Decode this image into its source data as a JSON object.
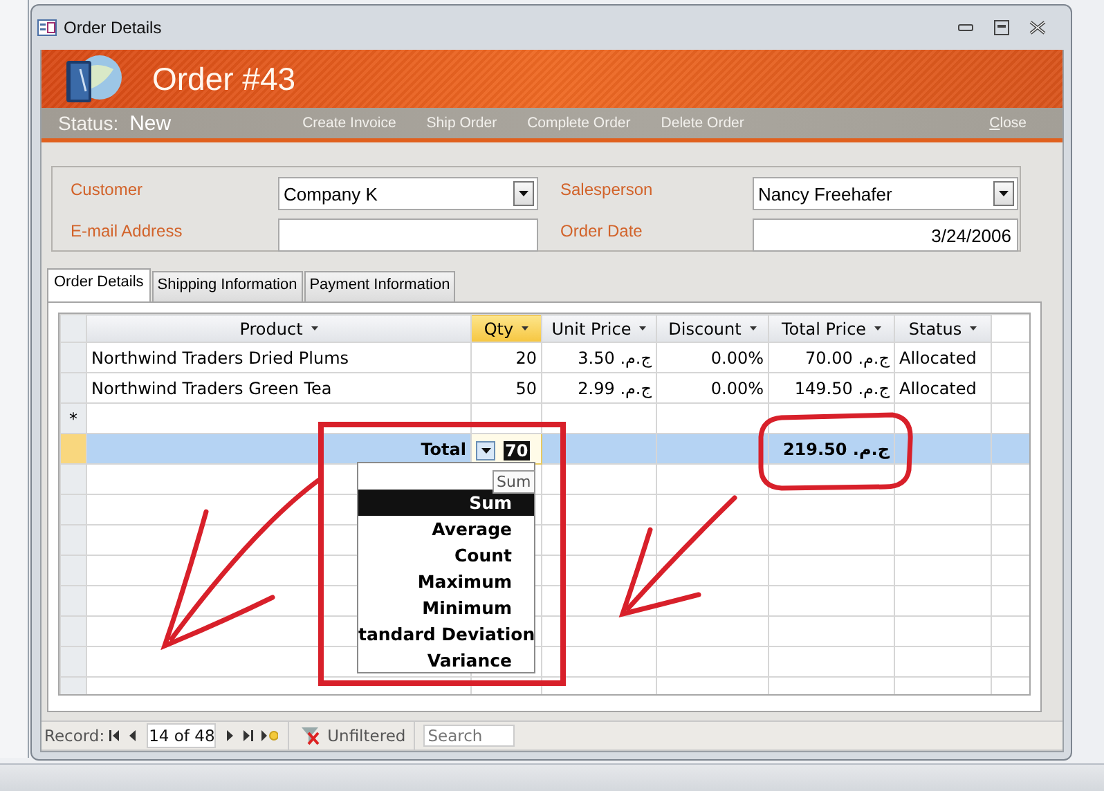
{
  "window": {
    "title": "Order Details"
  },
  "header": {
    "title": "Order #43"
  },
  "status_bar": {
    "label": "Status:",
    "value": "New",
    "actions": [
      {
        "label": "Create Invoice",
        "kind": "action"
      },
      {
        "label": "Ship Order",
        "kind": "action"
      },
      {
        "label": "Complete Order",
        "kind": "action"
      },
      {
        "label": "Delete Order",
        "kind": "action"
      },
      {
        "label": "Close",
        "kind": "close"
      }
    ]
  },
  "fields": [
    {
      "label": "Customer",
      "value": "Company K",
      "kind": "combo"
    },
    {
      "label": "Salesperson",
      "value": "Nancy Freehafer",
      "kind": "combo"
    },
    {
      "label": "E-mail Address",
      "kind": "text"
    },
    {
      "label": "Order Date",
      "value": "3/24/2006",
      "kind": "date"
    }
  ],
  "tabs": [
    {
      "label": "Order Details",
      "selected": true
    },
    {
      "label": "Shipping Information",
      "selected": false
    },
    {
      "label": "Payment Information",
      "selected": false
    }
  ],
  "table": {
    "columns": [
      {
        "label": "Product",
        "selected": false
      },
      {
        "label": "Qty",
        "selected": true
      },
      {
        "label": "Unit Price",
        "selected": false
      },
      {
        "label": "Discount",
        "selected": false
      },
      {
        "label": "Total Price",
        "selected": false
      },
      {
        "label": "Status",
        "selected": false
      }
    ],
    "rows": [
      [
        "Northwind Traders Dried Plums",
        "20",
        "ج.م. 3.50",
        "0.00%",
        "ج.م. 70.00",
        "Allocated"
      ],
      [
        "Northwind Traders Green Tea",
        "50",
        "ج.م. 2.99",
        "0.00%",
        "ج.م. 149.50",
        "Allocated"
      ]
    ],
    "new_row_marker": "*",
    "total_row": {
      "label": "Total",
      "qty": "70",
      "total_price": "ج.م. 219.50"
    }
  },
  "total_menu": {
    "tooltip": "Sum",
    "items": [
      {
        "label": "Sum",
        "selected": true
      },
      {
        "label": "Average",
        "selected": false
      },
      {
        "label": "Count",
        "selected": false
      },
      {
        "label": "Maximum",
        "selected": false
      },
      {
        "label": "Minimum",
        "selected": false
      },
      {
        "label": "tandard Deviation",
        "selected": false
      },
      {
        "label": "Variance",
        "selected": false
      }
    ]
  },
  "record_nav": {
    "label": "Record:",
    "position": "14 of 48",
    "filter": "Unfiltered",
    "search_placeholder": "Search"
  }
}
